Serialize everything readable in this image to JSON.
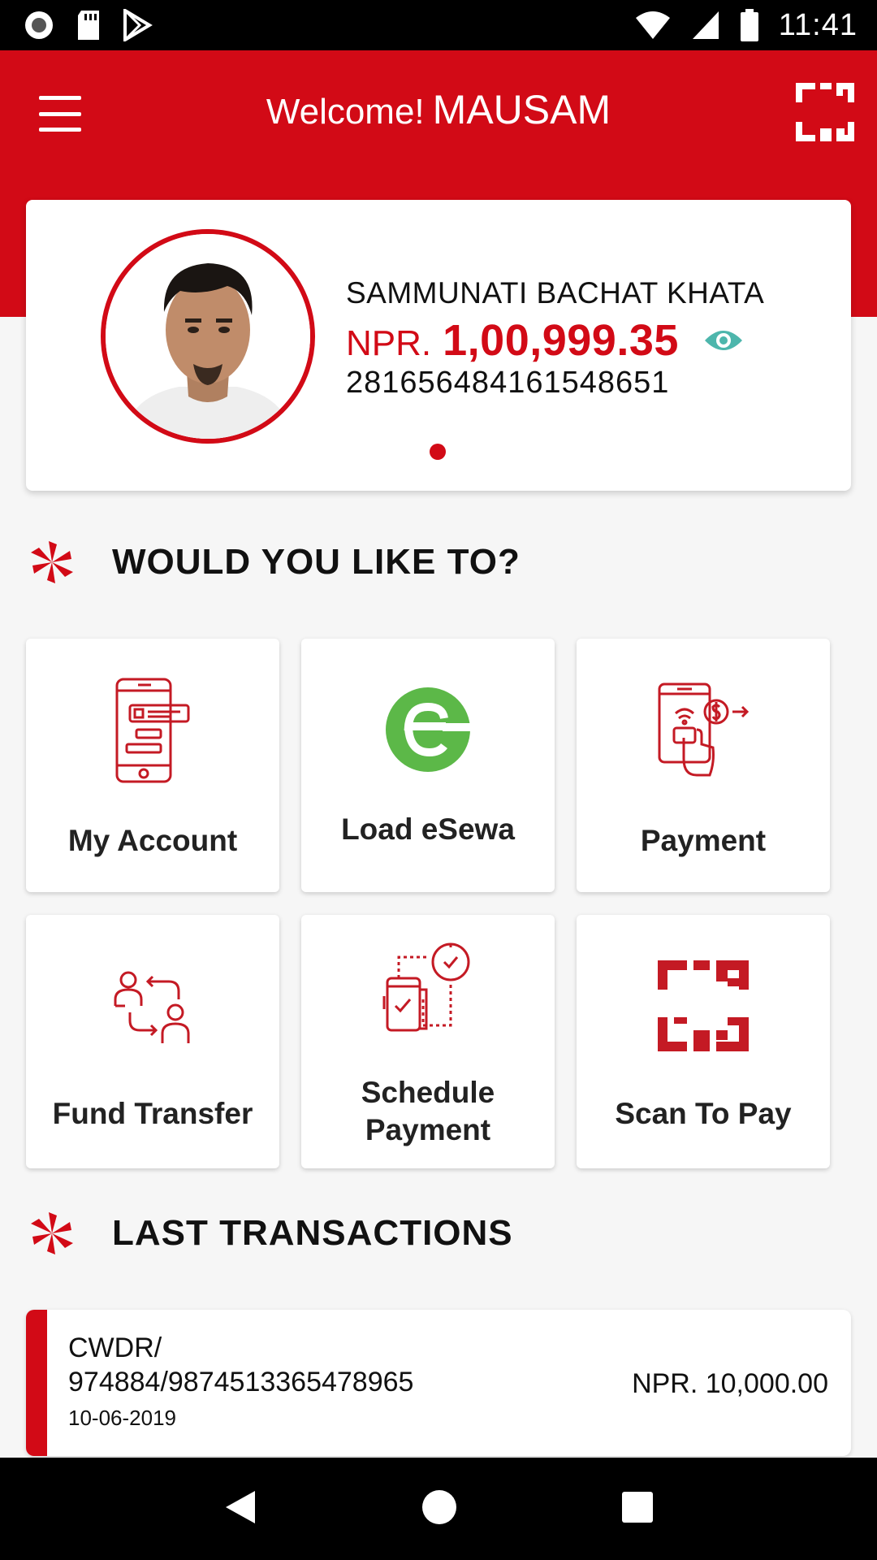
{
  "status_bar": {
    "time": "11:41"
  },
  "header": {
    "welcome": "Welcome!",
    "user_name": "MAUSAM"
  },
  "account": {
    "name": "SAMMUNATI BACHAT KHATA",
    "currency": "NPR.",
    "balance": "1,00,999.35",
    "number": "281656484161548651"
  },
  "sections": {
    "actions_title": "WOULD YOU LIKE TO?",
    "transactions_title": "LAST TRANSACTIONS"
  },
  "actions": [
    {
      "label": "My Account",
      "icon": "phone-account-icon"
    },
    {
      "label": "Load eSewa",
      "icon": "esewa-icon"
    },
    {
      "label": "Payment",
      "icon": "phone-payment-icon"
    },
    {
      "label": "Fund Transfer",
      "icon": "fund-transfer-icon"
    },
    {
      "label": "Schedule Payment",
      "icon": "schedule-payment-icon"
    },
    {
      "label": "Scan To Pay",
      "icon": "qr-scan-icon"
    }
  ],
  "transactions": [
    {
      "desc_line1": "CWDR/",
      "desc_line2": "974884/9874513365478965",
      "date": "10-06-2019",
      "amount": "NPR. 10,000.00"
    }
  ],
  "colors": {
    "brand": "#d20a16",
    "esewa_green": "#5cb848",
    "eye_teal": "#4db6ac"
  }
}
